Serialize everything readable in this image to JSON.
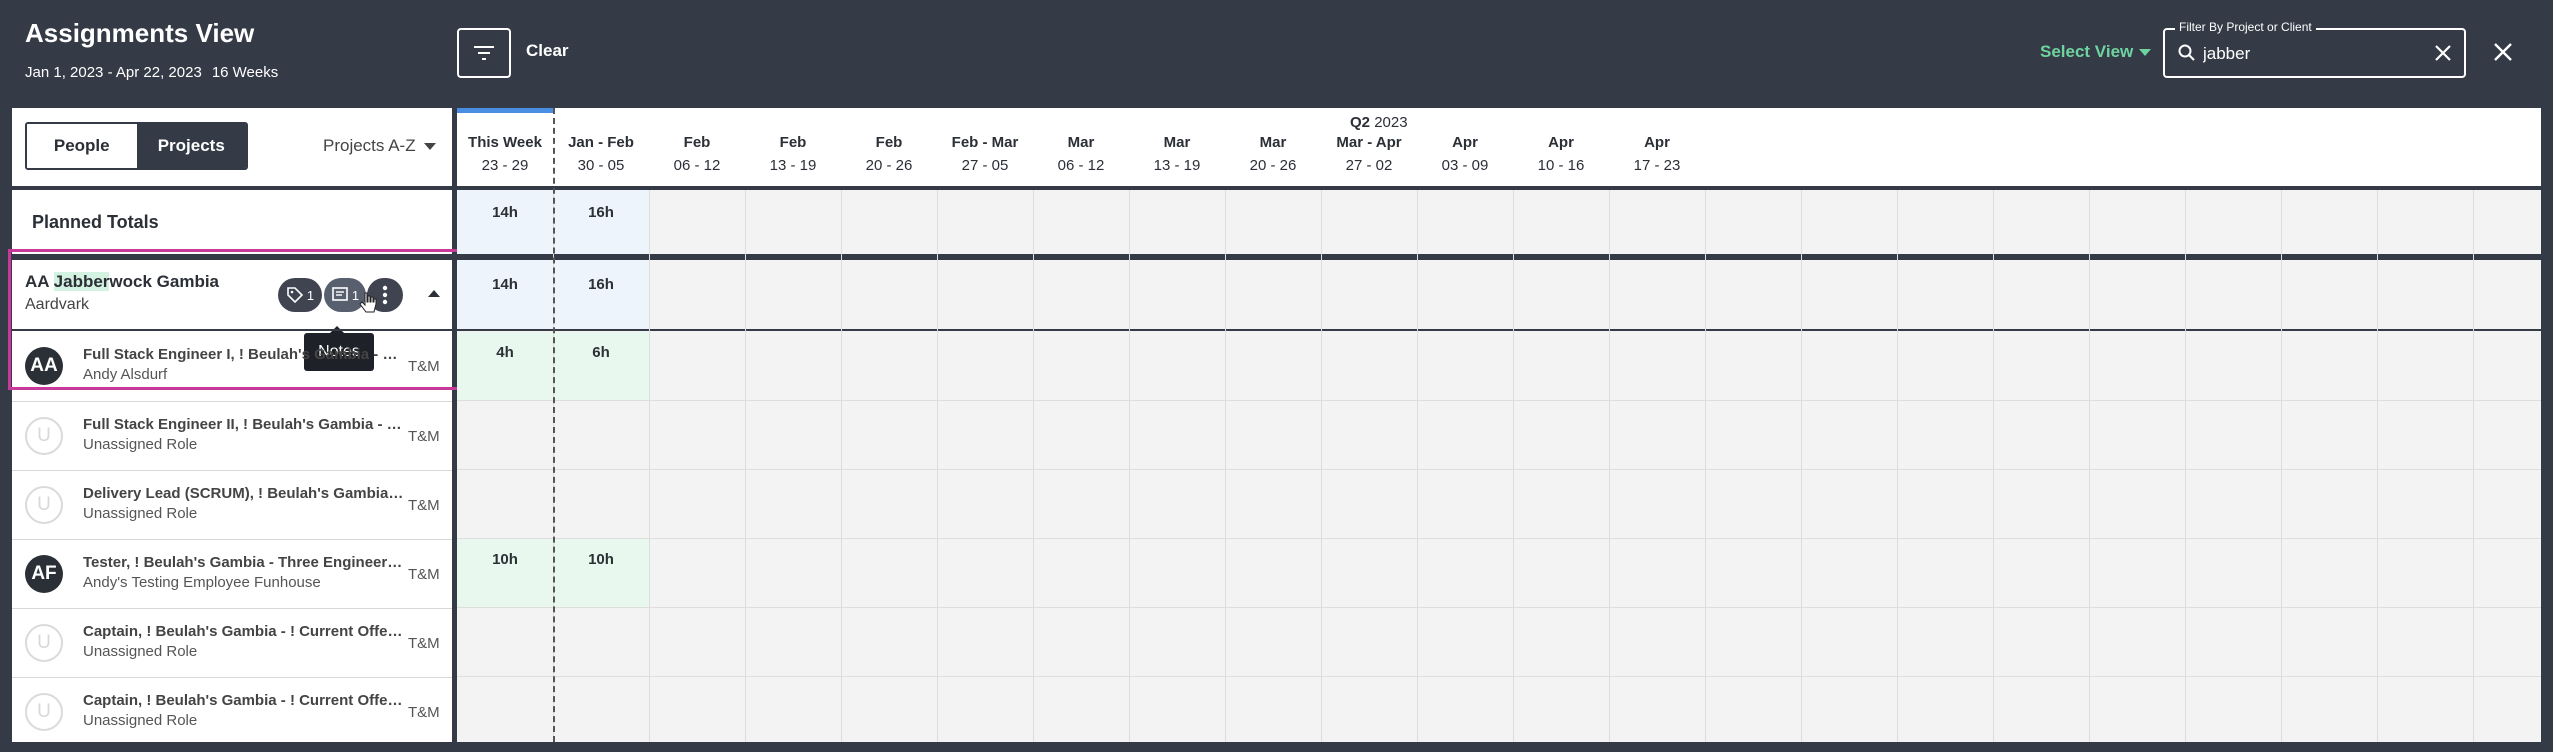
{
  "header": {
    "title": "Assignments View",
    "date_range": "Jan 1, 2023 - Apr 22, 2023",
    "weeks": "16 Weeks",
    "clear_label": "Clear",
    "select_view_label": "Select View",
    "search": {
      "label": "Filter By Project or Client",
      "value": "jabber"
    }
  },
  "sidebar": {
    "toggle": {
      "people": "People",
      "projects": "Projects",
      "active": "Projects"
    },
    "sort_label": "Projects A-Z",
    "planned_totals_label": "Planned Totals",
    "project": {
      "name_prefix": "AA ",
      "name_highlight": "Jabber",
      "name_suffix": "wock Gambia",
      "client": "Aardvark",
      "tag_count": "1",
      "notes_count": "1",
      "tooltip": "Notes"
    },
    "rows": [
      {
        "avatar": "AA",
        "title": "Full Stack Engineer I, ! Beulah's Gambia - Three Engineers",
        "person": "Andy Alsdurf",
        "billing": "T&M",
        "assigned": true
      },
      {
        "avatar": "U",
        "title": "Full Stack Engineer II, ! Beulah's Gambia - Three Engineers",
        "person": "Unassigned Role",
        "billing": "T&M",
        "assigned": false
      },
      {
        "avatar": "U",
        "title": "Delivery Lead (SCRUM), ! Beulah's Gambia - Three Engineers",
        "person": "Unassigned Role",
        "billing": "T&M",
        "assigned": false
      },
      {
        "avatar": "AF",
        "title": "Tester, ! Beulah's Gambia - Three Engineers- Funhouse",
        "person": "Andy's Testing Employee Funhouse",
        "billing": "T&M",
        "assigned": true
      },
      {
        "avatar": "U",
        "title": "Captain, ! Beulah's Gambia - ! Current Offering",
        "person": "Unassigned Role",
        "billing": "T&M",
        "assigned": false
      },
      {
        "avatar": "U",
        "title": "Captain, ! Beulah's Gambia - ! Current Offering",
        "person": "Unassigned Role",
        "billing": "T&M",
        "assigned": false
      }
    ]
  },
  "timeline": {
    "quarter_label": "Q2",
    "quarter_year": "2023",
    "columns": [
      {
        "month": "This Week",
        "days": "23 - 29"
      },
      {
        "month": "Jan - Feb",
        "days": "30 - 05"
      },
      {
        "month": "Feb",
        "days": "06 - 12"
      },
      {
        "month": "Feb",
        "days": "13 - 19"
      },
      {
        "month": "Feb",
        "days": "20 - 26"
      },
      {
        "month": "Feb - Mar",
        "days": "27 - 05"
      },
      {
        "month": "Mar",
        "days": "06 - 12"
      },
      {
        "month": "Mar",
        "days": "13 - 19"
      },
      {
        "month": "Mar",
        "days": "20 - 26"
      },
      {
        "month": "Mar - Apr",
        "days": "27 - 02"
      },
      {
        "month": "Apr",
        "days": "03 - 09"
      },
      {
        "month": "Apr",
        "days": "10 - 16"
      },
      {
        "month": "Apr",
        "days": "17 - 23"
      }
    ],
    "planned_totals": [
      "14h",
      "16h"
    ],
    "project_totals": [
      "14h",
      "16h"
    ],
    "row_hours": [
      [
        "4h",
        "6h"
      ],
      [],
      [],
      [
        "10h",
        "10h"
      ],
      [],
      []
    ]
  },
  "colors": {
    "header_bg": "#343a46",
    "accent_green": "#6fd3a0",
    "week_bar": "#4a8ee3",
    "highlight_box": "#c8399a"
  }
}
